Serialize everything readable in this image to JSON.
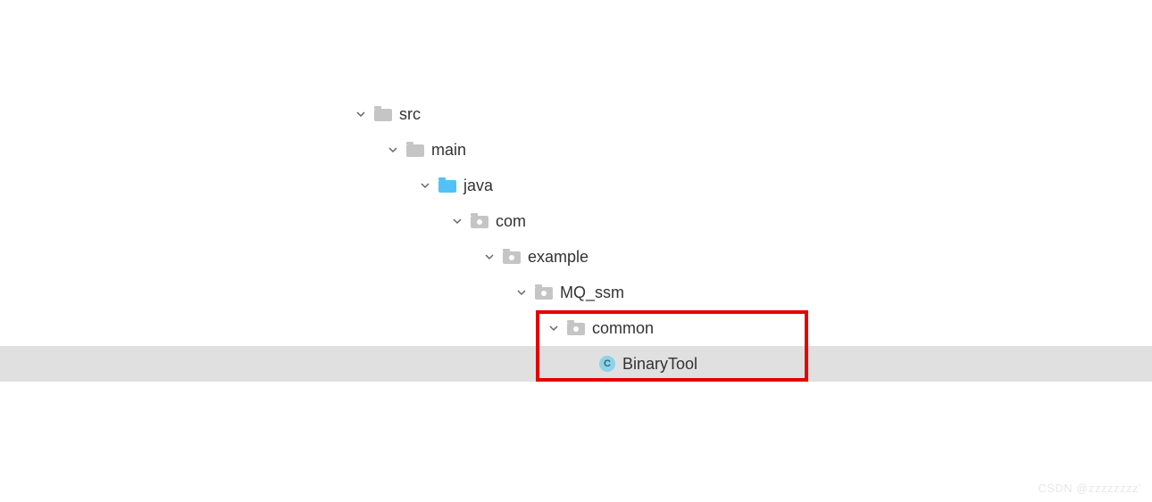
{
  "tree": {
    "src": "src",
    "main": "main",
    "java": "java",
    "com": "com",
    "example": "example",
    "mq_ssm": "MQ_ssm",
    "common": "common",
    "binary_tool": "BinaryTool"
  },
  "class_icon_letter": "C",
  "watermark": "CSDN @zzzzzzzz'"
}
